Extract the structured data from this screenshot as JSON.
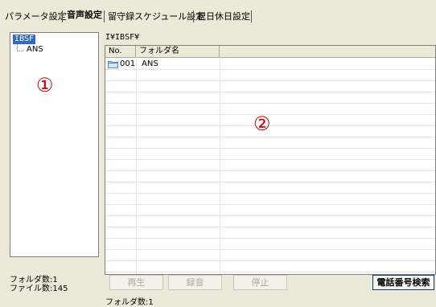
{
  "tabs": [
    {
      "label": "パラメータ設定",
      "active": false
    },
    {
      "label": "音声設定",
      "active": true
    },
    {
      "label": "留守録スケジュール設定",
      "active": false
    },
    {
      "label": "祝日休日設定",
      "active": false
    }
  ],
  "tree": {
    "root": "IBSF",
    "children": [
      "ANS"
    ]
  },
  "markers": {
    "tree": "①",
    "list": "②"
  },
  "path": "I¥IBSF¥",
  "list": {
    "columns": [
      "No.",
      "フォルダ名"
    ],
    "rows": [
      {
        "no": "001",
        "name": "ANS",
        "icon": "folder-icon"
      }
    ]
  },
  "status": {
    "folders": "フォルダ数:1",
    "files": "ファイル数:145",
    "bottom": "フォルダ数:1"
  },
  "buttons": {
    "play": "再生",
    "record": "録音",
    "stop": "停止",
    "phone_search": "電話番号検索"
  },
  "colors": {
    "background": "#ece9d8",
    "selection": "#316ac5",
    "marker": "#d00000"
  }
}
